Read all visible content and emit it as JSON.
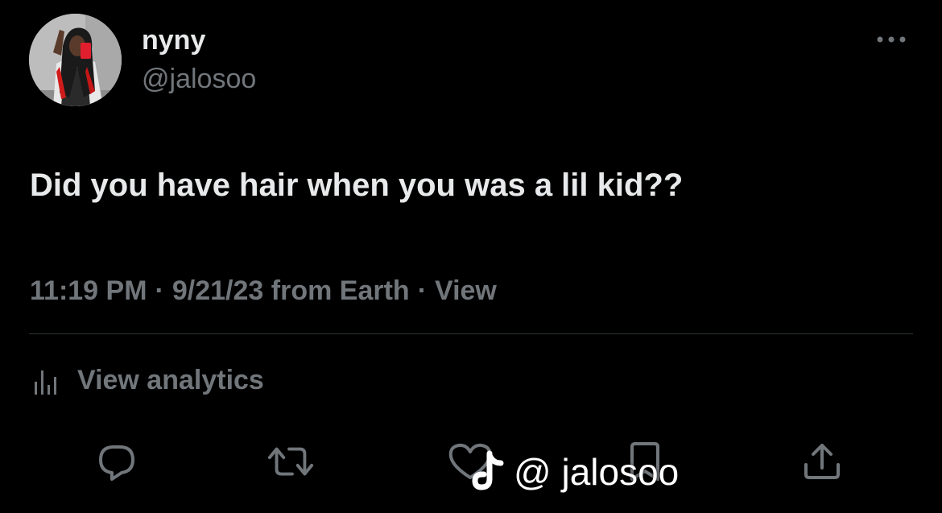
{
  "tweet": {
    "display_name": "nyny",
    "handle": "@jalosoo",
    "text": "Did you have hair when you was a lil kid??",
    "time": "11:19 PM",
    "date": "9/21/23",
    "source": "from Earth",
    "separator": "·",
    "view_label": "View"
  },
  "analytics": {
    "label": "View analytics",
    "icon": "bar-chart-icon"
  },
  "actions": [
    {
      "name": "reply",
      "icon": "speech-bubble-icon"
    },
    {
      "name": "retweet",
      "icon": "retweet-icon"
    },
    {
      "name": "like",
      "icon": "heart-icon"
    },
    {
      "name": "bookmark",
      "icon": "bookmark-icon"
    },
    {
      "name": "share",
      "icon": "share-icon"
    }
  ],
  "watermark": {
    "text": "@ jalosoo",
    "icon": "tiktok-logo-icon"
  },
  "colors": {
    "background": "#000000",
    "primary_text": "#e7e9ea",
    "secondary_text": "#71767b",
    "divider": "#2f3336"
  }
}
